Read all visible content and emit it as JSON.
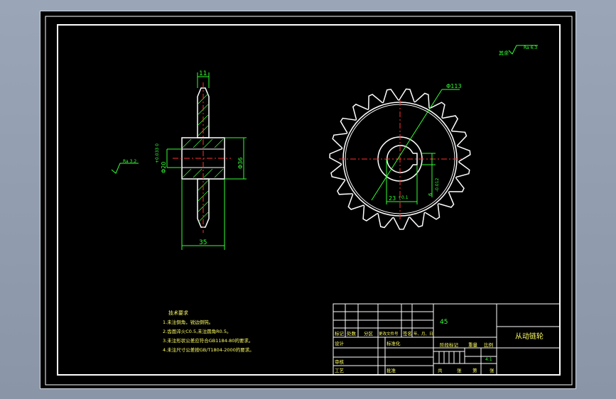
{
  "drawing": {
    "title": "从动链轮",
    "material": "45",
    "scale": "4:1",
    "roughness_other": "其余",
    "roughness_other_value": "Ra 6.3",
    "roughness_left_value": "Ra 3.2"
  },
  "dims": {
    "width_top": "11",
    "bore": "Φ20",
    "bore_tol": "+0.033 0",
    "hub": "Φ36",
    "width_bottom": "35",
    "outer": "Φ113",
    "key_depth": "23",
    "key_depth_tol": "+0.1",
    "key_width": "6",
    "key_width_tol": "-0.012"
  },
  "notes": {
    "heading": "技术要求",
    "items": [
      "1.未注倒角，锐边倒钝。",
      "2.齿面淬火C0.5,未注圆角R0.5。",
      "3.未注形状公差应符合GB1184-80的要求。",
      "4.未注尺寸公差按GB/T1804-2000的要求。"
    ]
  },
  "title_block": {
    "labels_row": [
      "标记",
      "处数",
      "分区",
      "更改文件号",
      "签名",
      "年、月、日"
    ],
    "design": "设计",
    "std": "标准化",
    "check": "审核",
    "craft": "工艺",
    "approve": "批准",
    "stage": "阶段标记",
    "weight": "重量",
    "scale_label": "比例",
    "sheet_total": "共",
    "sheet": "张",
    "sheet_num": "第",
    "sheet2": "张"
  }
}
